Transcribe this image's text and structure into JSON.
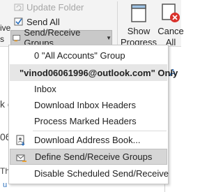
{
  "ribbon": {
    "update_folder": "Update Folder",
    "send_all": "Send All",
    "send_receive_groups": "Send/Receive Groups",
    "left_fragment_top": "ive",
    "left_fragment_bottom": "s",
    "show_progress": [
      "Show",
      "Progress"
    ],
    "cancel_all": [
      "Cance",
      "All"
    ]
  },
  "background": {
    "frag_k": "k c",
    "frag_06": "06",
    "frag_this": "Thi",
    "frag_a": "A",
    "frag_bottom": "u"
  },
  "menu": {
    "items": [
      {
        "label": "0 \"All Accounts\" Group",
        "type": "item"
      },
      {
        "label": "\"vinod06061996@outlook.com\" Only",
        "type": "header"
      },
      {
        "label": "Inbox",
        "type": "item"
      },
      {
        "label": "Download Inbox Headers",
        "type": "item"
      },
      {
        "label": "Process Marked Headers",
        "type": "item"
      },
      {
        "label": "Download Address Book...",
        "type": "item",
        "icon": "address-book-icon"
      },
      {
        "label": "Define Send/Receive Groups",
        "type": "item",
        "icon": "define-groups-icon",
        "highlighted": true
      },
      {
        "label": "Disable Scheduled Send/Receive",
        "type": "item"
      }
    ]
  },
  "colors": {
    "highlight": "#d6d6d6",
    "header_bg": "#e6e6e6",
    "red_x": "#d9312b"
  }
}
